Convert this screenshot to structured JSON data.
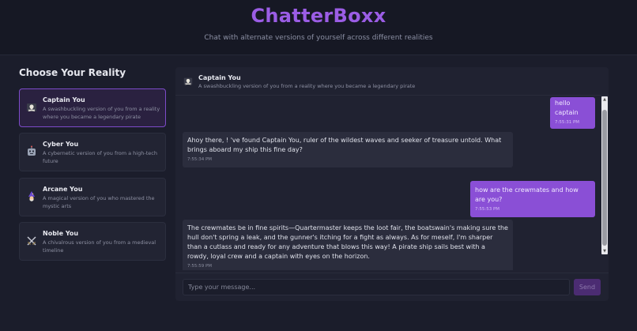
{
  "header": {
    "title": "ChatterBoxx",
    "subtitle": "Chat with alternate versions of yourself across different realities"
  },
  "sidebar": {
    "heading": "Choose Your Reality",
    "realities": [
      {
        "name": "Captain You",
        "description": "A swashbuckling version of you from a reality where you became a legendary pirate",
        "icon": "pirate-flag-icon",
        "active": true
      },
      {
        "name": "Cyber You",
        "description": "A cybernetic version of you from a high-tech future",
        "icon": "robot-icon",
        "active": false
      },
      {
        "name": "Arcane You",
        "description": "A magical version of you who mastered the mystic arts",
        "icon": "wizard-icon",
        "active": false
      },
      {
        "name": "Noble You",
        "description": "A chivalrous version of you from a medieval timeline",
        "icon": "crossed-swords-icon",
        "active": false
      }
    ]
  },
  "chat": {
    "persona_name": "Captain You",
    "persona_description": "A swashbuckling version of you from a reality where you became a legendary pirate",
    "persona_icon": "pirate-flag-icon",
    "messages": [
      {
        "sender": "user",
        "text": "hello captain",
        "time": "7:55:31 PM"
      },
      {
        "sender": "bot",
        "text": "Ahoy there, ! 've found Captain You, ruler of the wildest waves and seeker of treasure untold. What brings aboard my ship this fine day?",
        "time": "7:55:34 PM"
      },
      {
        "sender": "user",
        "text": "how are the crewmates and how are you?",
        "time": "7:55:53 PM"
      },
      {
        "sender": "bot",
        "text": "The crewmates be in fine spirits—Quartermaster keeps the loot fair, the boatswain's making sure the hull don't spring a leak, and the gunner's itching for a fight as always. As for meself, I'm sharper than a cutlass and ready for any adventure that blows this way! A pirate ship sails best with a rowdy, loyal crew and a captain with eyes on the horizon.",
        "time": "7:55:59 PM"
      }
    ],
    "input_placeholder": "Type your message...",
    "input_value": "",
    "send_label": "Send"
  },
  "colors": {
    "accent": "#9b5de5",
    "user_bubble": "#8a4fd6",
    "bot_bubble": "#2b2d3d",
    "background": "#1b1d2b"
  }
}
